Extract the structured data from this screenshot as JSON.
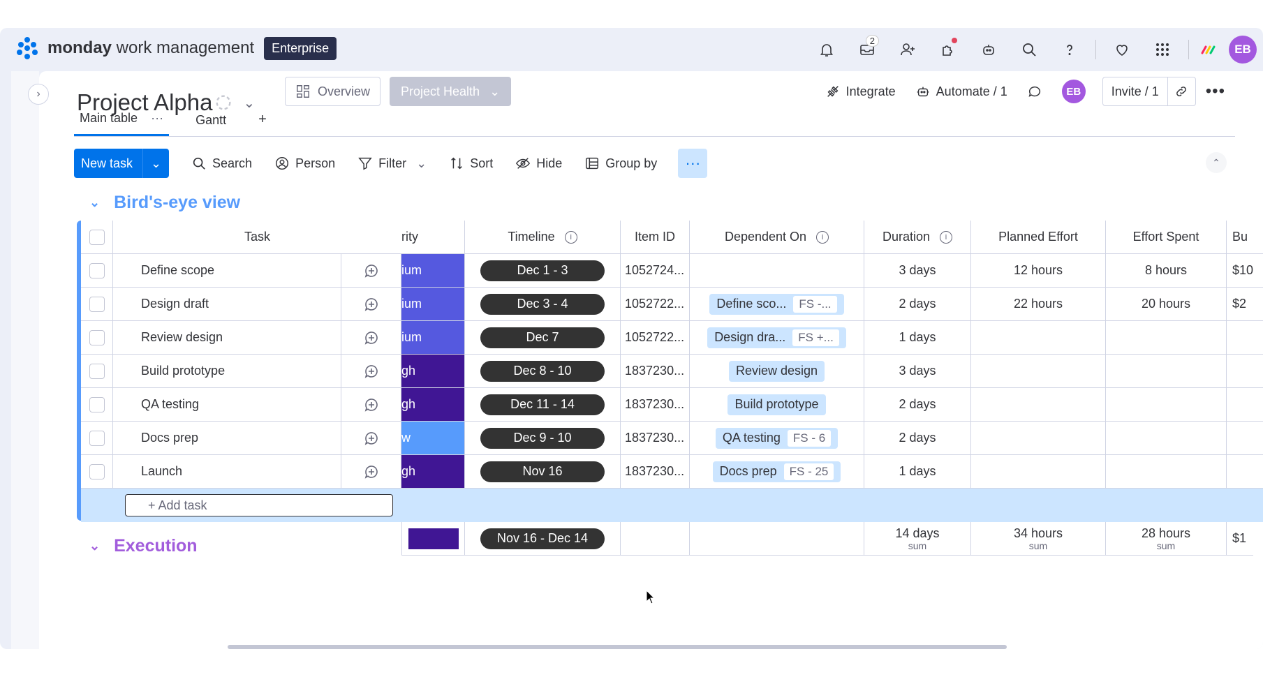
{
  "app": {
    "brand_bold": "monday",
    "brand_rest": " work management",
    "plan_badge": "Enterprise",
    "inbox_count": "2",
    "avatar_initials": "EB",
    "accent": "#0073ea"
  },
  "topbar_icons": [
    "bell-icon",
    "inbox-icon",
    "invite-members-icon",
    "apps-icon",
    "ai-assistant-icon",
    "search-icon",
    "help-icon",
    "heart-icon",
    "apps-grid-icon",
    "monday-products-icon"
  ],
  "board": {
    "title": "Project Alpha",
    "overview_label": "Overview",
    "project_health_label": "Project Health",
    "integrate_label": "Integrate",
    "automate_label": "Automate / 1",
    "invite_label": "Invite / 1",
    "owner_initials": "EB"
  },
  "tabs": [
    {
      "label": "Main table"
    },
    {
      "label": "Gantt"
    },
    {
      "label": "+"
    }
  ],
  "toolbar": {
    "new_task": "New task",
    "search": "Search",
    "person": "Person",
    "filter": "Filter",
    "sort": "Sort",
    "hide": "Hide",
    "group_by": "Group by",
    "more": "···"
  },
  "groups": [
    {
      "title": "Bird's-eye view",
      "color": "#579bfc"
    },
    {
      "title": "Execution",
      "color": "#a25ddc"
    }
  ],
  "columns": {
    "task": "Task",
    "priority": "rity",
    "timeline": "Timeline",
    "item_id": "Item ID",
    "dependent_on": "Dependent On",
    "duration": "Duration",
    "planned_effort": "Planned Effort",
    "effort_spent": "Effort Spent",
    "budget": "Bu"
  },
  "rows": [
    {
      "task": "Define scope",
      "priority": "ium",
      "priority_color": "#5559df",
      "timeline": "Dec 1 - 3",
      "item_id": "1052724...",
      "dep": "",
      "dep_fs": "",
      "duration": "3 days",
      "planned": "12 hours",
      "spent": "8 hours",
      "budget": "$10"
    },
    {
      "task": "Design draft",
      "priority": "ium",
      "priority_color": "#5559df",
      "timeline": "Dec 3 - 4",
      "item_id": "1052722...",
      "dep": "Define sco...",
      "dep_fs": "FS -...",
      "duration": "2 days",
      "planned": "22 hours",
      "spent": "20 hours",
      "budget": "$2"
    },
    {
      "task": "Review design",
      "priority": "ium",
      "priority_color": "#5559df",
      "timeline": "Dec 7",
      "item_id": "1052722...",
      "dep": "Design dra...",
      "dep_fs": "FS +...",
      "duration": "1 days",
      "planned": "",
      "spent": "",
      "budget": ""
    },
    {
      "task": "Build prototype",
      "priority": "gh",
      "priority_color": "#401694",
      "timeline": "Dec 8 - 10",
      "item_id": "1837230...",
      "dep": "Review design",
      "dep_fs": "",
      "duration": "3 days",
      "planned": "",
      "spent": "",
      "budget": ""
    },
    {
      "task": "QA testing",
      "priority": "gh",
      "priority_color": "#401694",
      "timeline": "Dec 11 - 14",
      "item_id": "1837230...",
      "dep": "Build prototype",
      "dep_fs": "",
      "duration": "2 days",
      "planned": "",
      "spent": "",
      "budget": ""
    },
    {
      "task": "Docs prep",
      "priority": "w",
      "priority_color": "#579bfc",
      "timeline": "Dec 9 - 10",
      "item_id": "1837230...",
      "dep": "QA testing",
      "dep_fs": "FS - 6",
      "duration": "2 days",
      "planned": "",
      "spent": "",
      "budget": ""
    },
    {
      "task": "Launch",
      "priority": "gh",
      "priority_color": "#401694",
      "timeline": "Nov 16",
      "item_id": "1837230...",
      "dep": "Docs prep",
      "dep_fs": "FS - 25",
      "duration": "1 days",
      "planned": "",
      "spent": "",
      "budget": ""
    }
  ],
  "add_task_label": "+ Add task",
  "summary": {
    "priority_color": "#401694",
    "timeline": "Nov 16 - Dec 14",
    "duration": "14 days",
    "planned": "34 hours",
    "spent": "28 hours",
    "budget": "$1",
    "sum_label": "sum"
  }
}
